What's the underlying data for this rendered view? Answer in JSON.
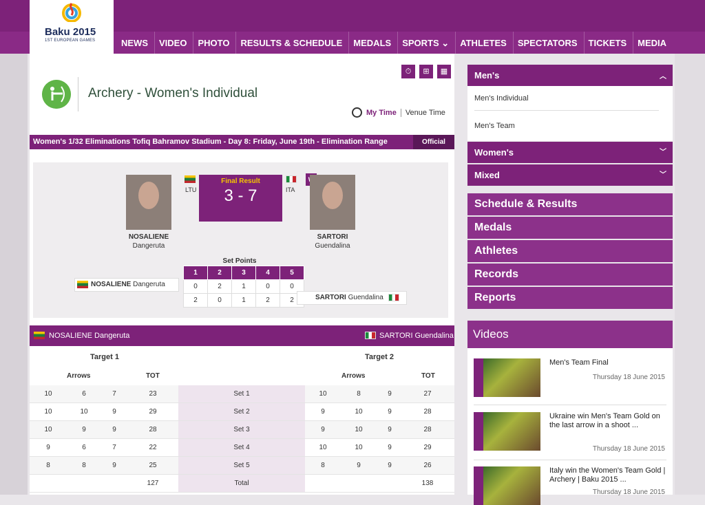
{
  "header": {
    "logo_title": "Baku 2015",
    "logo_subtitle": "1ST EUROPEAN GAMES",
    "nav": [
      "NEWS",
      "VIDEO",
      "PHOTO",
      "RESULTS & SCHEDULE",
      "MEDALS",
      "SPORTS",
      "ATHLETES",
      "SPECTATORS",
      "TICKETS",
      "MEDIA"
    ]
  },
  "main": {
    "title": "Archery - Women's Individual",
    "my_time": "My Time",
    "venue_time": "Venue Time",
    "event_line": "Women's 1/32 Eliminations  Tofiq Bahramov Stadium - Day 8: Friday, June 19th - Elimination Range",
    "official": "Official"
  },
  "result": {
    "final_label": "Final Result",
    "score": "3 - 7",
    "winner_badge": "W",
    "athlete1": {
      "surname": "NOSALIENE",
      "first": "Dangeruta",
      "noc": "LTU",
      "full": "NOSALIENE Dangeruta"
    },
    "athlete2": {
      "surname": "SARTORI",
      "first": "Guendalina",
      "noc": "ITA",
      "full": "SARTORI Guendalina"
    },
    "set_points_title": "Set Points",
    "set_headers": [
      "1",
      "2",
      "3",
      "4",
      "5"
    ],
    "set_row1": [
      "0",
      "2",
      "1",
      "0",
      "0"
    ],
    "set_row2": [
      "2",
      "0",
      "1",
      "2",
      "2"
    ]
  },
  "scores": {
    "athlete1": "NOSALIENE Dangeruta",
    "athlete2": "SARTORI Guendalina",
    "target1": "Target 1",
    "target2": "Target 2",
    "arrows": "Arrows",
    "tot": "TOT",
    "rows": [
      {
        "a1": [
          "10",
          "6",
          "7"
        ],
        "t1": "23",
        "label": "Set 1",
        "a2": [
          "10",
          "8",
          "9"
        ],
        "t2": "27"
      },
      {
        "a1": [
          "10",
          "10",
          "9"
        ],
        "t1": "29",
        "label": "Set 2",
        "a2": [
          "9",
          "10",
          "9"
        ],
        "t2": "28"
      },
      {
        "a1": [
          "10",
          "9",
          "9"
        ],
        "t1": "28",
        "label": "Set 3",
        "a2": [
          "9",
          "10",
          "9"
        ],
        "t2": "28"
      },
      {
        "a1": [
          "9",
          "6",
          "7"
        ],
        "t1": "22",
        "label": "Set 4",
        "a2": [
          "10",
          "10",
          "9"
        ],
        "t2": "29"
      },
      {
        "a1": [
          "8",
          "8",
          "9"
        ],
        "t1": "25",
        "label": "Set 5",
        "a2": [
          "8",
          "9",
          "9"
        ],
        "t2": "26"
      }
    ],
    "total_label": "Total",
    "total1": "127",
    "total2": "138"
  },
  "sidebar": {
    "mens": "Men's",
    "mens_items": [
      "Men's Individual",
      "Men's Team"
    ],
    "womens": "Women's",
    "mixed": "Mixed",
    "menu": [
      "Schedule & Results",
      "Medals",
      "Athletes",
      "Records",
      "Reports"
    ],
    "videos_title": "Videos",
    "videos": [
      {
        "title": "Men's Team Final",
        "date": "Thursday 18 June 2015"
      },
      {
        "title": "Ukraine win Men's Team Gold on the last arrow in a shoot ...",
        "date": "Thursday 18 June 2015"
      },
      {
        "title": "Italy win the Women's Team Gold | Archery | Baku 2015 ...",
        "date": "Thursday 18 June 2015"
      }
    ]
  }
}
